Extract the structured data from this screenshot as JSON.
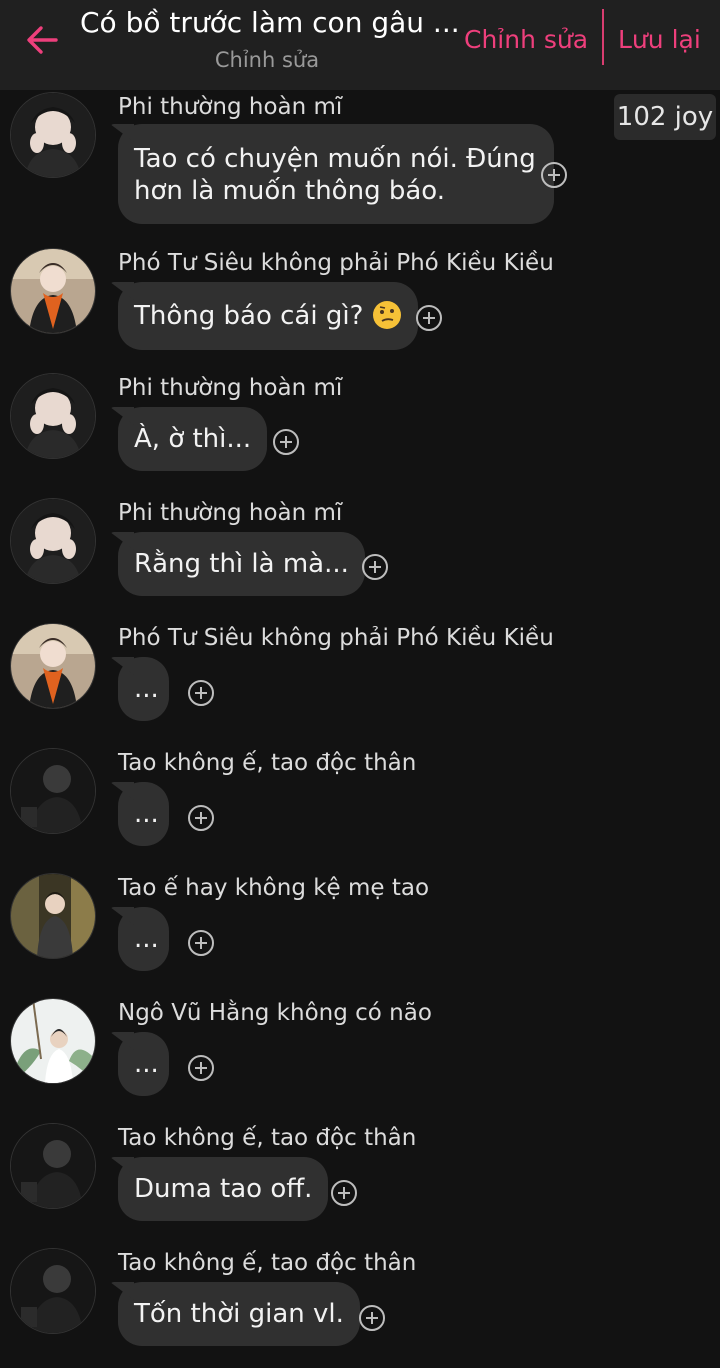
{
  "header": {
    "title": "Có bồ trước làm con gâu ...",
    "subtitle": "Chỉnh sửa",
    "edit_label": "Chỉnh sửa",
    "save_label": "Lưu lại",
    "accent_color": "#ee3f7c"
  },
  "badge": {
    "joy": "102 joy"
  },
  "messages": [
    {
      "author": "Phi thường hoàn mĩ",
      "text": "Tao có chuyện muốn nói. Đúng\nhơn là muốn thông báo.",
      "avatar": "avatar-a"
    },
    {
      "author": "Phó Tư Siêu không phải Phó Kiều Kiều",
      "text": "Thông báo cái gì?",
      "emoji": "thinking-face-icon",
      "avatar": "avatar-b"
    },
    {
      "author": "Phi thường hoàn mĩ",
      "text": "À, ờ thì...",
      "avatar": "avatar-a"
    },
    {
      "author": "Phi thường hoàn mĩ",
      "text": "Rằng thì là mà...",
      "avatar": "avatar-a"
    },
    {
      "author": "Phó Tư Siêu không phải Phó Kiều Kiều",
      "text": "...",
      "avatar": "avatar-b"
    },
    {
      "author": "Tao không ế, tao độc thân",
      "text": "...",
      "avatar": "avatar-c"
    },
    {
      "author": "Tao ế hay không kệ mẹ tao",
      "text": "...",
      "avatar": "avatar-d"
    },
    {
      "author": "Ngô Vũ Hằng không có não",
      "text": "...",
      "avatar": "avatar-e"
    },
    {
      "author": "Tao không ế, tao độc thân",
      "text": "Duma tao off.",
      "avatar": "avatar-c"
    },
    {
      "author": "Tao không ế, tao độc thân",
      "text": "Tốn thời gian vl.",
      "avatar": "avatar-c"
    }
  ]
}
